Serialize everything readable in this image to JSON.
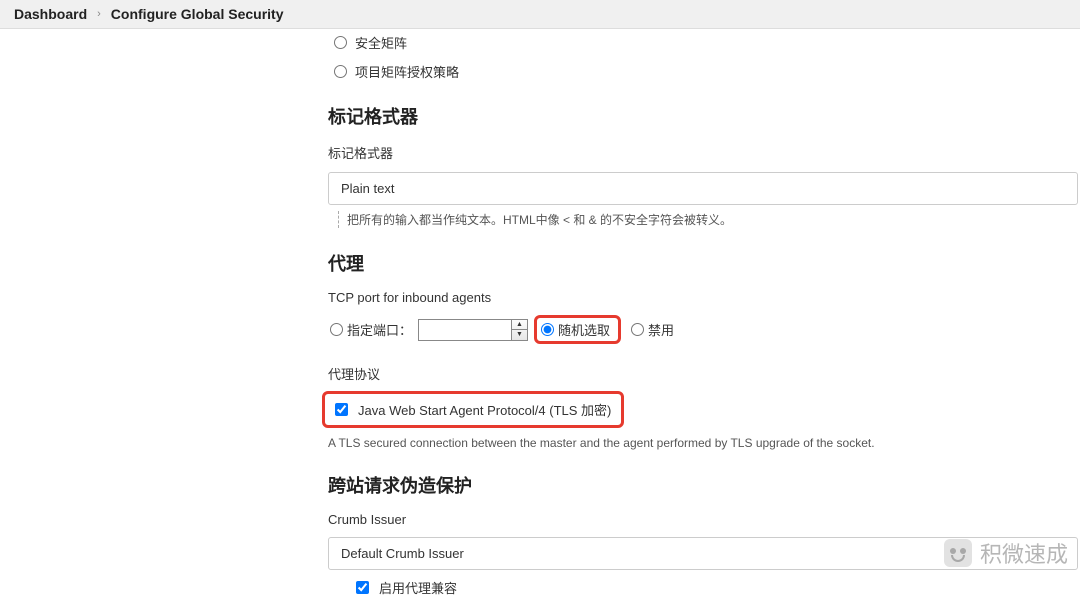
{
  "breadcrumb": {
    "dashboard": "Dashboard",
    "sep": "›",
    "page": "Configure Global Security"
  },
  "authz": {
    "opt_safematrix": "安全矩阵",
    "opt_projectmatrix": "项目矩阵授权策略"
  },
  "markup": {
    "title": "标记格式器",
    "label": "标记格式器",
    "value": "Plain text",
    "hint": "把所有的输入都当作纯文本。HTML中像 < 和 & 的不安全字符会被转义。"
  },
  "agent": {
    "title": "代理",
    "tcp_label": "TCP port for inbound agents",
    "fixed": "指定端口：",
    "random": "随机选取",
    "disabled": "禁用",
    "protocol_label": "代理协议",
    "protocol_option": "Java Web Start Agent Protocol/4 (TLS 加密)",
    "tls_note": "A TLS secured connection between the master and the agent performed by TLS upgrade of the socket."
  },
  "csrf": {
    "title": "跨站请求伪造保护",
    "issuer_label": "Crumb Issuer",
    "issuer_value": "Default Crumb Issuer",
    "proxy_compat": "启用代理兼容"
  },
  "watermark": "积微速成"
}
